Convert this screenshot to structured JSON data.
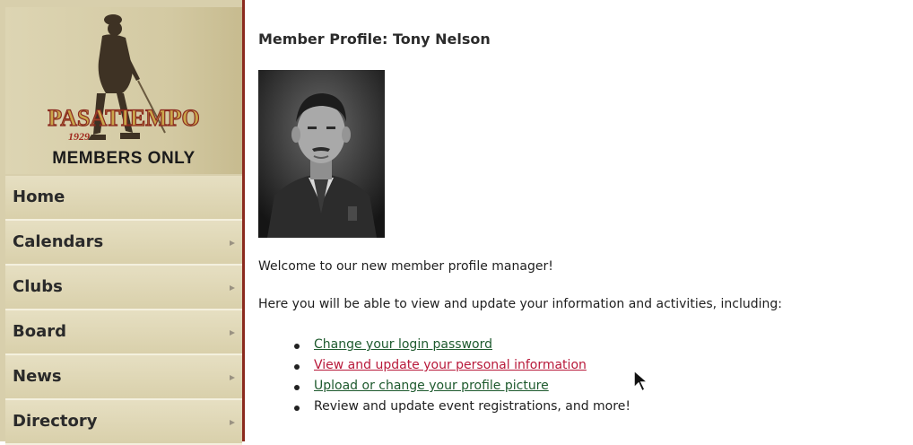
{
  "logo": {
    "brand": "PASATIEMPO",
    "year": "1929",
    "tagline": "MEMBERS ONLY"
  },
  "nav": {
    "items": [
      {
        "label": "Home",
        "has_submenu": false
      },
      {
        "label": "Calendars",
        "has_submenu": true
      },
      {
        "label": "Clubs",
        "has_submenu": true
      },
      {
        "label": "Board",
        "has_submenu": true
      },
      {
        "label": "News",
        "has_submenu": true
      },
      {
        "label": "Directory",
        "has_submenu": true
      }
    ]
  },
  "main": {
    "title": "Member Profile: Tony Nelson",
    "welcome": "Welcome to our new member profile manager!",
    "intro": "Here you will be able to view and update your information and activities, including:",
    "bullets": [
      {
        "text": "Change your login password",
        "is_link": true
      },
      {
        "text": "View and update your personal information",
        "is_link": true
      },
      {
        "text": "Upload or change your profile picture",
        "is_link": true
      },
      {
        "text": "Review and update event registrations, and more!",
        "is_link": false
      }
    ]
  },
  "colors": {
    "sidebar_bg": "#d8cfac",
    "sidebar_border": "#8b2a1e",
    "link": "#1e5a2e",
    "link_hover": "#b8193a",
    "logo_red": "#a02a1e"
  }
}
